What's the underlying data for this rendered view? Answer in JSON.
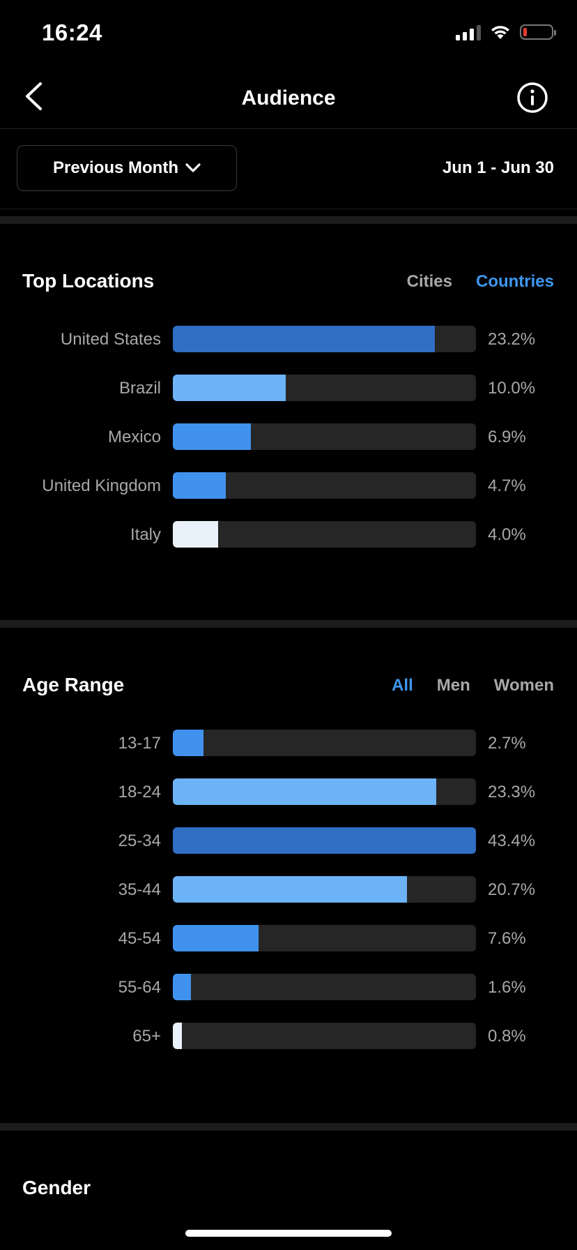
{
  "status_bar": {
    "time": "16:24",
    "icons": [
      "signal-icon",
      "wifi-icon",
      "battery-icon"
    ],
    "battery_color": "#e53935"
  },
  "nav": {
    "title": "Audience",
    "back_icon": "chevron-left-icon",
    "info_icon": "info-icon"
  },
  "filter": {
    "period_label": "Previous Month",
    "period_icon": "chevron-down-icon",
    "date_range": "Jun 1 - Jun 30"
  },
  "top_locations": {
    "title": "Top Locations",
    "tabs": [
      {
        "label": "Cities",
        "active": false
      },
      {
        "label": "Countries",
        "active": true
      }
    ],
    "rows": [
      {
        "label": "United States",
        "value": "23.2%",
        "fraction": 0.232,
        "color": "#2f6fc4"
      },
      {
        "label": "Brazil",
        "value": "10.0%",
        "fraction": 0.1,
        "color": "#6cb3f7"
      },
      {
        "label": "Mexico",
        "value": "6.9%",
        "fraction": 0.069,
        "color": "#4192ee"
      },
      {
        "label": "United Kingdom",
        "value": "4.7%",
        "fraction": 0.047,
        "color": "#4192ee"
      },
      {
        "label": "Italy",
        "value": "4.0%",
        "fraction": 0.04,
        "color": "#e9f2fb"
      }
    ]
  },
  "age_range": {
    "title": "Age Range",
    "tabs": [
      {
        "label": "All",
        "active": true
      },
      {
        "label": "Men",
        "active": false
      },
      {
        "label": "Women",
        "active": false
      }
    ],
    "rows": [
      {
        "label": "13-17",
        "value": "2.7%",
        "fraction": 0.027,
        "color": "#4192ee"
      },
      {
        "label": "18-24",
        "value": "23.3%",
        "fraction": 0.233,
        "color": "#6cb3f7"
      },
      {
        "label": "25-34",
        "value": "43.4%",
        "fraction": 0.434,
        "color": "#2f6fc4"
      },
      {
        "label": "35-44",
        "value": "20.7%",
        "fraction": 0.207,
        "color": "#6cb3f7"
      },
      {
        "label": "45-54",
        "value": "7.6%",
        "fraction": 0.076,
        "color": "#4192ee"
      },
      {
        "label": "55-64",
        "value": "1.6%",
        "fraction": 0.016,
        "color": "#4192ee"
      },
      {
        "label": "65+",
        "value": "0.8%",
        "fraction": 0.008,
        "color": "#e9f2fb"
      }
    ]
  },
  "gender": {
    "title": "Gender"
  },
  "colors": {
    "background": "#000000",
    "track": "#262626",
    "accent": "#3f97f0",
    "muted_text": "#a8a8a8"
  }
}
